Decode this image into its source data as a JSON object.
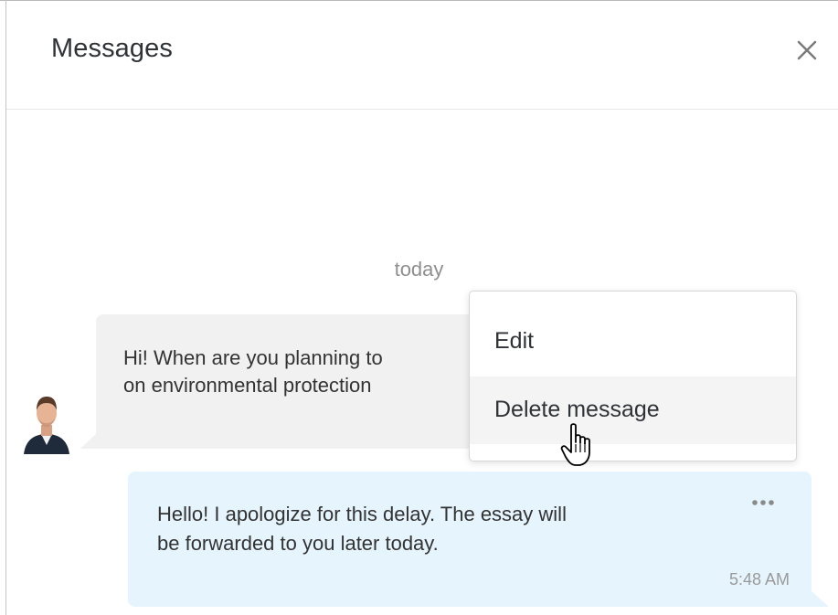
{
  "header": {
    "title": "Messages",
    "close_icon": "close-icon"
  },
  "conversation": {
    "date_separator": "today",
    "incoming": {
      "text": "Hi! When are you planning to send the essay on environmental protection?",
      "line1": "Hi! When are you planning to",
      "line2": "on environmental protection",
      "avatar_icon": "user-avatar"
    },
    "outgoing": {
      "line1": "Hello! I apologize for this delay. The essay will",
      "line2": "be forwarded to you later today.",
      "time": "5:48 AM",
      "more_icon": "more-horizontal-icon"
    }
  },
  "context_menu": {
    "items": [
      {
        "label": "Edit"
      },
      {
        "label": "Delete message",
        "state": "hovered"
      }
    ]
  },
  "colors": {
    "incoming_bubble": "#f1f1f1",
    "outgoing_bubble": "#e5f4fd",
    "menu_hover": "#f4f4f4",
    "muted_text": "#8f8f8f"
  }
}
